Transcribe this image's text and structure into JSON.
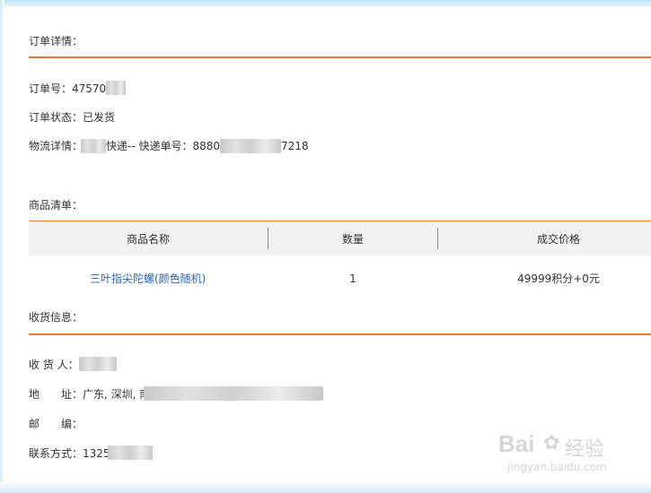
{
  "order": {
    "section_title": "订单详情：",
    "number_label": "订单号：",
    "number_value": "47570",
    "status_label": "订单状态：",
    "status_value": "已发货",
    "logistics_label": "物流详情：",
    "logistics_courier_suffix": "快递-- 快递单号：",
    "tracking_prefix": "8880",
    "tracking_suffix": "7218"
  },
  "goods": {
    "section_title": "商品清单：",
    "columns": [
      "商品名称",
      "数量",
      "成交价格"
    ],
    "rows": [
      {
        "name": "三叶指尖陀螺(颜色随机)",
        "qty": "1",
        "price": "49999积分+0元"
      }
    ]
  },
  "receiver": {
    "section_title": "收货信息：",
    "name_label": "收 货 人：",
    "address_label": "地",
    "address_label_2": "址：",
    "address_value": "广东, 深圳, 南",
    "postcode_label": "邮",
    "postcode_label_2": "编：",
    "contact_label": "联系方式：",
    "contact_value": "1325"
  },
  "watermark": {
    "brand": "Bai",
    "brand_tail": "经验",
    "url": "jingyan.baidu.com"
  },
  "colors": {
    "accent_rule": "#e8783a",
    "link": "#2a63b8",
    "table_header_bg": "#f2f2f2"
  }
}
